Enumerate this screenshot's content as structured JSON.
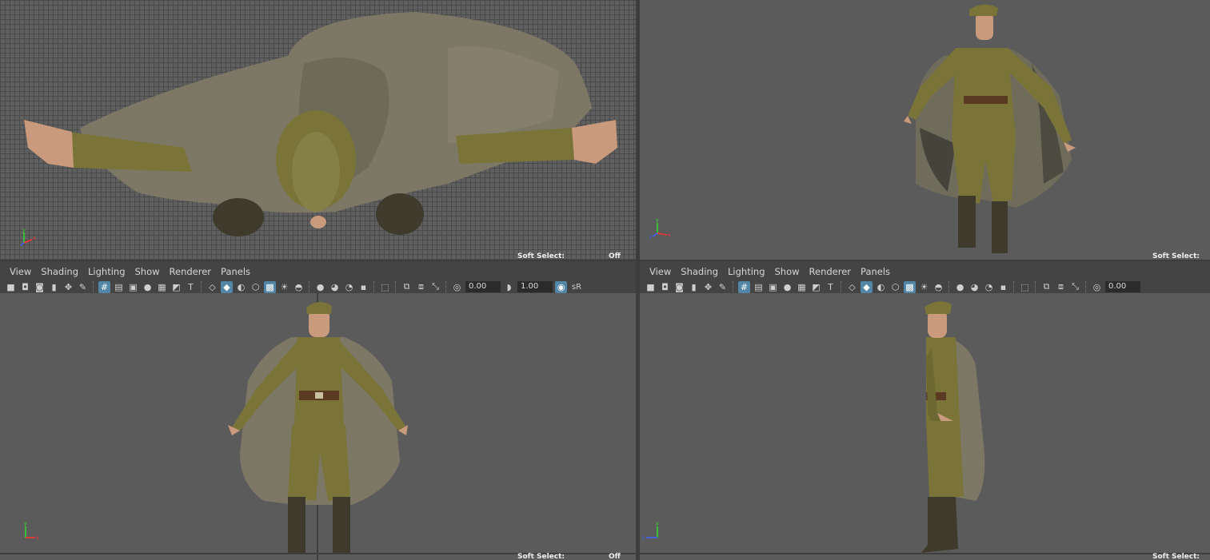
{
  "panels": {
    "menu": [
      "View",
      "Shading",
      "Lighting",
      "Show",
      "Renderer",
      "Panels"
    ],
    "left_toolbar": {
      "field1": "0.00",
      "field2": "1.00",
      "srgb": "sR"
    },
    "right_toolbar": {
      "field1": "0.00"
    }
  },
  "soft_select": {
    "label": "Soft Select:",
    "value": "Off"
  },
  "axis_labels": {
    "x": "x",
    "y": "y",
    "z": "z"
  },
  "colors": {
    "viewport_bg": "#5d5d5d",
    "uniform": "#7a7438",
    "cape": "#7d7766",
    "skin": "#c99a7c",
    "boots": "#3e3a2c",
    "belt": "#5a3a22",
    "accent": "#5285a6",
    "axis_x": "#ff3030",
    "axis_y": "#30e030",
    "axis_z": "#4060ff"
  }
}
